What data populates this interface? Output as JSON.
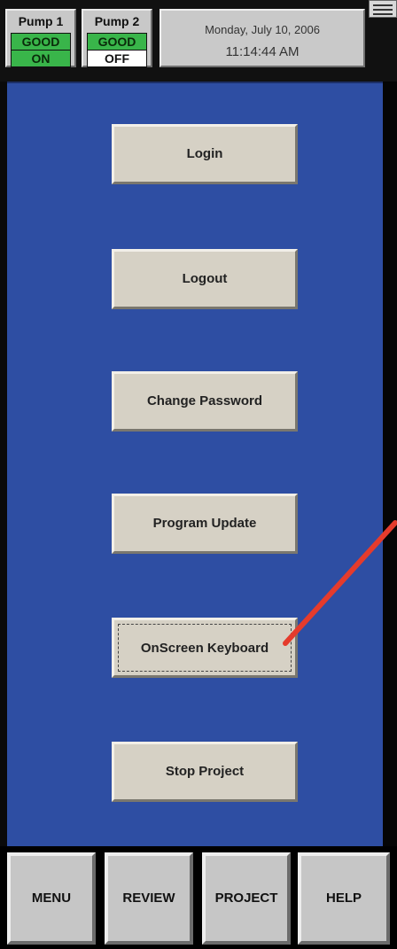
{
  "status": {
    "pumps": [
      {
        "name": "Pump 1",
        "health": "GOOD",
        "state": "ON"
      },
      {
        "name": "Pump 2",
        "health": "GOOD",
        "state": "OFF"
      }
    ],
    "date": "Monday, July 10, 2006",
    "time": "11:14:44 AM"
  },
  "menu": {
    "buttons": [
      "Login",
      "Logout",
      "Change Password",
      "Program Update",
      "OnScreen Keyboard",
      "Stop Project"
    ]
  },
  "nav": {
    "buttons": [
      "MENU",
      "REVIEW",
      "PROJECT",
      "HELP"
    ]
  },
  "colors": {
    "panel": "#2e4ea3",
    "status_good": "#39b54a",
    "annotation_arrow": "#e53b2c"
  }
}
